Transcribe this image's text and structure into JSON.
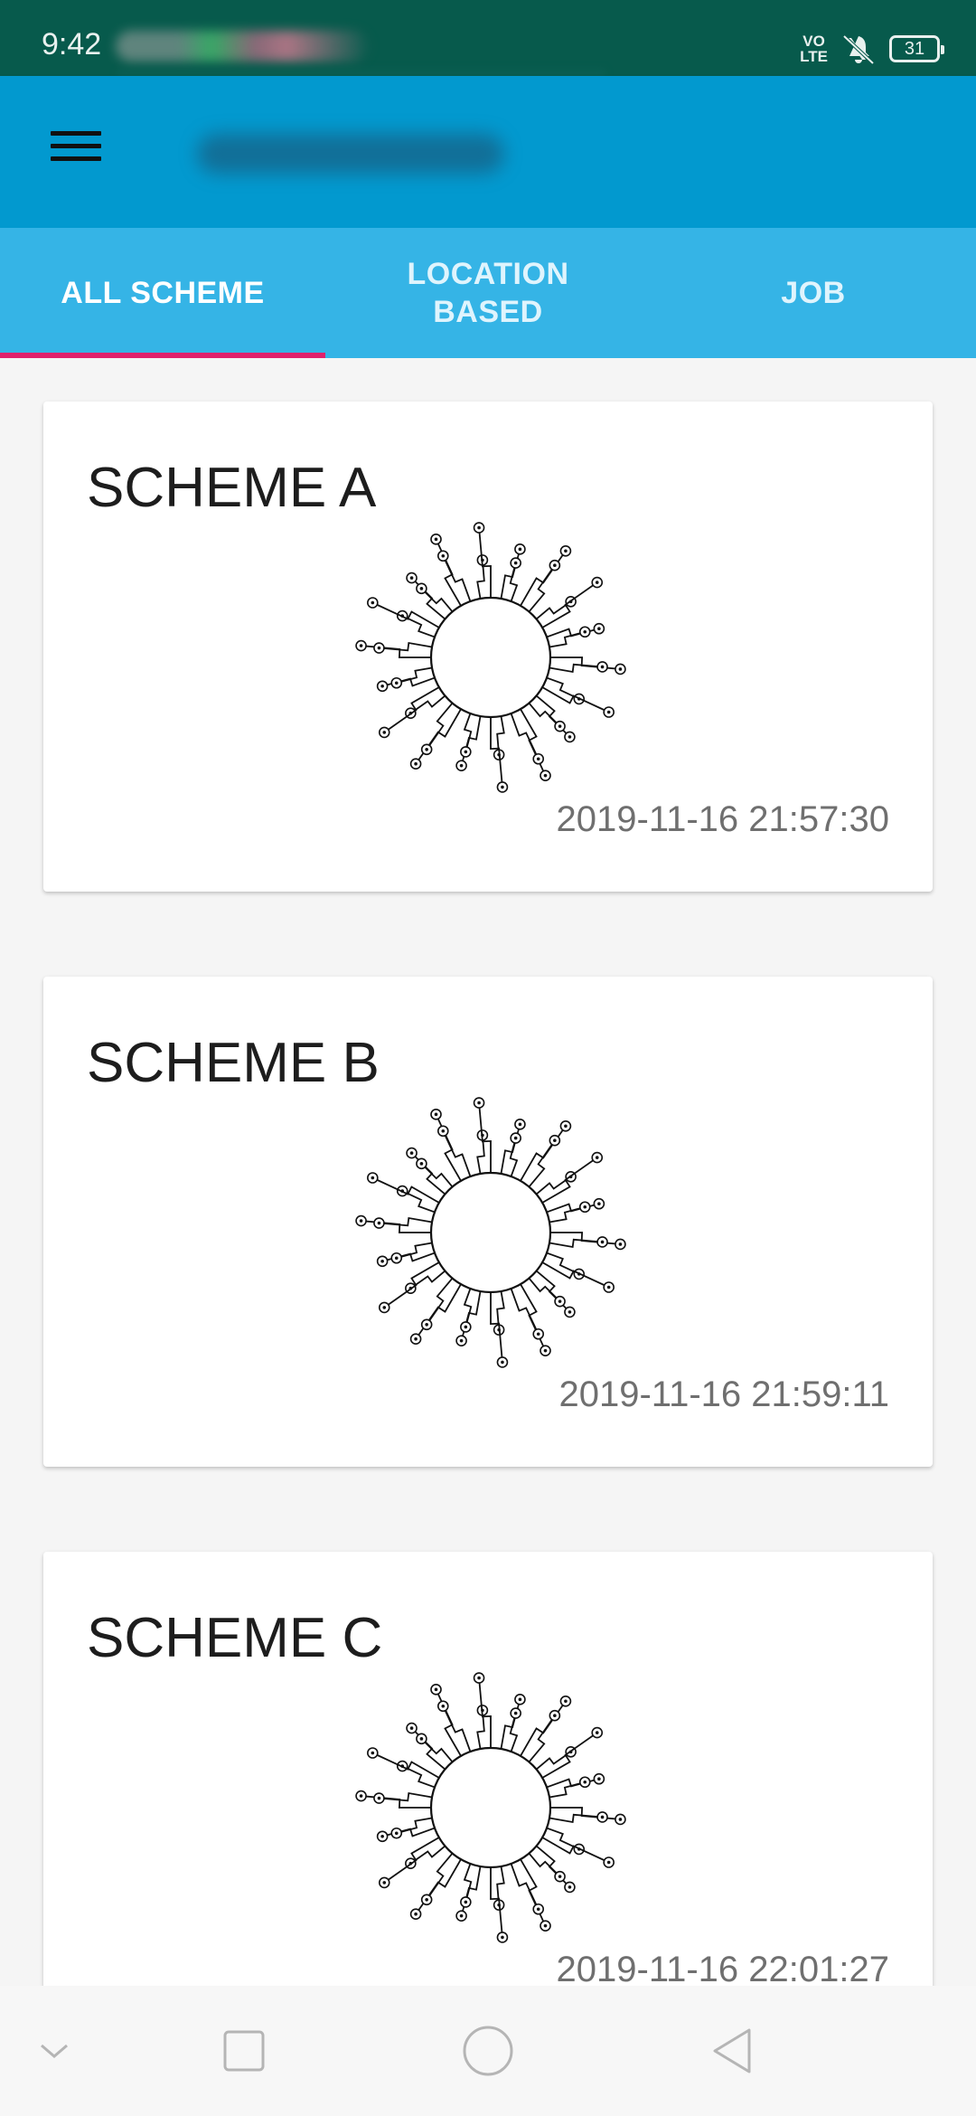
{
  "status_bar": {
    "time": "9:42",
    "volte": "VO\nLTE",
    "battery": "31"
  },
  "tabs": [
    {
      "label": "ALL SCHEME",
      "active": true
    },
    {
      "label_line1": "LOCATION",
      "label_line2": "BASED",
      "active": false
    },
    {
      "label": "JOB",
      "active": false
    }
  ],
  "schemes": [
    {
      "title": "SCHEME A",
      "timestamp": "2019-11-16 21:57:30"
    },
    {
      "title": "SCHEME B",
      "timestamp": "2019-11-16 21:59:11"
    },
    {
      "title": "SCHEME C",
      "timestamp": "2019-11-16 22:01:27"
    }
  ],
  "colors": {
    "status_bar": "#075a4c",
    "app_bar": "#0299cf",
    "tab_bar": "#35b4e6",
    "tab_indicator": "#e0216c"
  },
  "icons": {
    "menu": "hamburger-icon",
    "nav_down": "chevron-down-icon",
    "nav_recents": "square-icon",
    "nav_home": "circle-icon",
    "nav_back": "triangle-back-icon"
  }
}
